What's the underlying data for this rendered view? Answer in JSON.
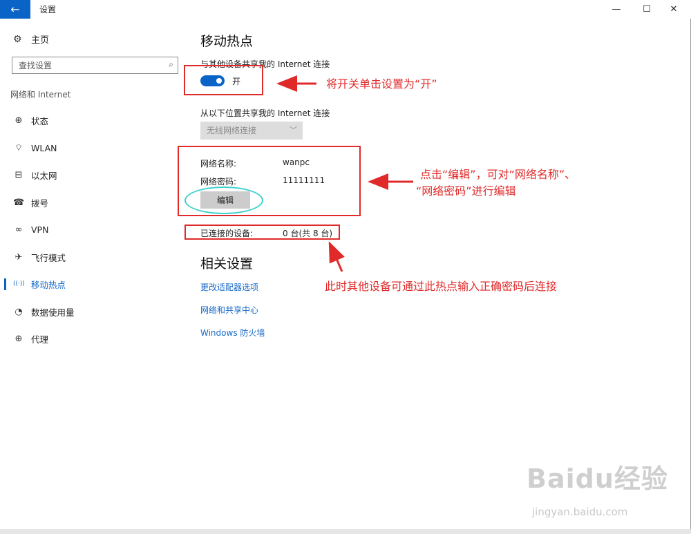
{
  "window": {
    "title": "设置",
    "back_glyph": "←",
    "minimize_glyph": "—",
    "maximize_glyph": "☐",
    "close_glyph": "✕"
  },
  "sidebar": {
    "home_label": "主页",
    "search_placeholder": "查找设置",
    "group_label": "网络和 Internet",
    "items": [
      {
        "label": "状态",
        "icon": "globe-status-icon",
        "glyph": "⊕"
      },
      {
        "label": "WLAN",
        "icon": "wifi-icon",
        "glyph": "ℹ"
      },
      {
        "label": "以太网",
        "icon": "ethernet-icon",
        "glyph": "⊟"
      },
      {
        "label": "拨号",
        "icon": "dialup-icon",
        "glyph": "☎"
      },
      {
        "label": "VPN",
        "icon": "vpn-icon",
        "glyph": "∞"
      },
      {
        "label": "飞行模式",
        "icon": "airplane-icon",
        "glyph": "✈"
      },
      {
        "label": "移动热点",
        "icon": "hotspot-icon",
        "glyph": "((·))"
      },
      {
        "label": "数据使用量",
        "icon": "data-usage-icon",
        "glyph": "◔"
      },
      {
        "label": "代理",
        "icon": "proxy-icon",
        "glyph": "⊕"
      }
    ],
    "active_index": 6
  },
  "main": {
    "title": "移动热点",
    "share_label": "与其他设备共享我的 Internet 连接",
    "toggle_state": "开",
    "toggle_on": true,
    "share_from_label": "从以下位置共享我的 Internet 连接",
    "share_from_value": "无线网络连接",
    "network_name_label": "网络名称:",
    "network_name_value": "wanpc",
    "network_password_label": "网络密码:",
    "network_password_value": "11111111",
    "edit_button": "编辑",
    "connected_label": "已连接的设备:",
    "connected_value": "0 台(共 8 台)",
    "related_title": "相关设置",
    "links": [
      "更改适配器选项",
      "网络和共享中心",
      "Windows 防火墙"
    ]
  },
  "annotations": {
    "toggle_note": "将开关单击设置为“开”",
    "edit_note_line1": "点击“编辑”，可对“网络名称”、",
    "edit_note_line2": "“网络密码”进行编辑",
    "connect_note": "此时其他设备可通过此热点输入正确密码后连接",
    "color": "#e02a2a"
  },
  "watermark": {
    "text": "Baidu经验",
    "sub": "jingyan.baidu.com"
  },
  "colors": {
    "accent": "#0a64c8",
    "link": "#1769c8",
    "annotation": "#e02a2a",
    "oval": "#3dd0cc"
  }
}
